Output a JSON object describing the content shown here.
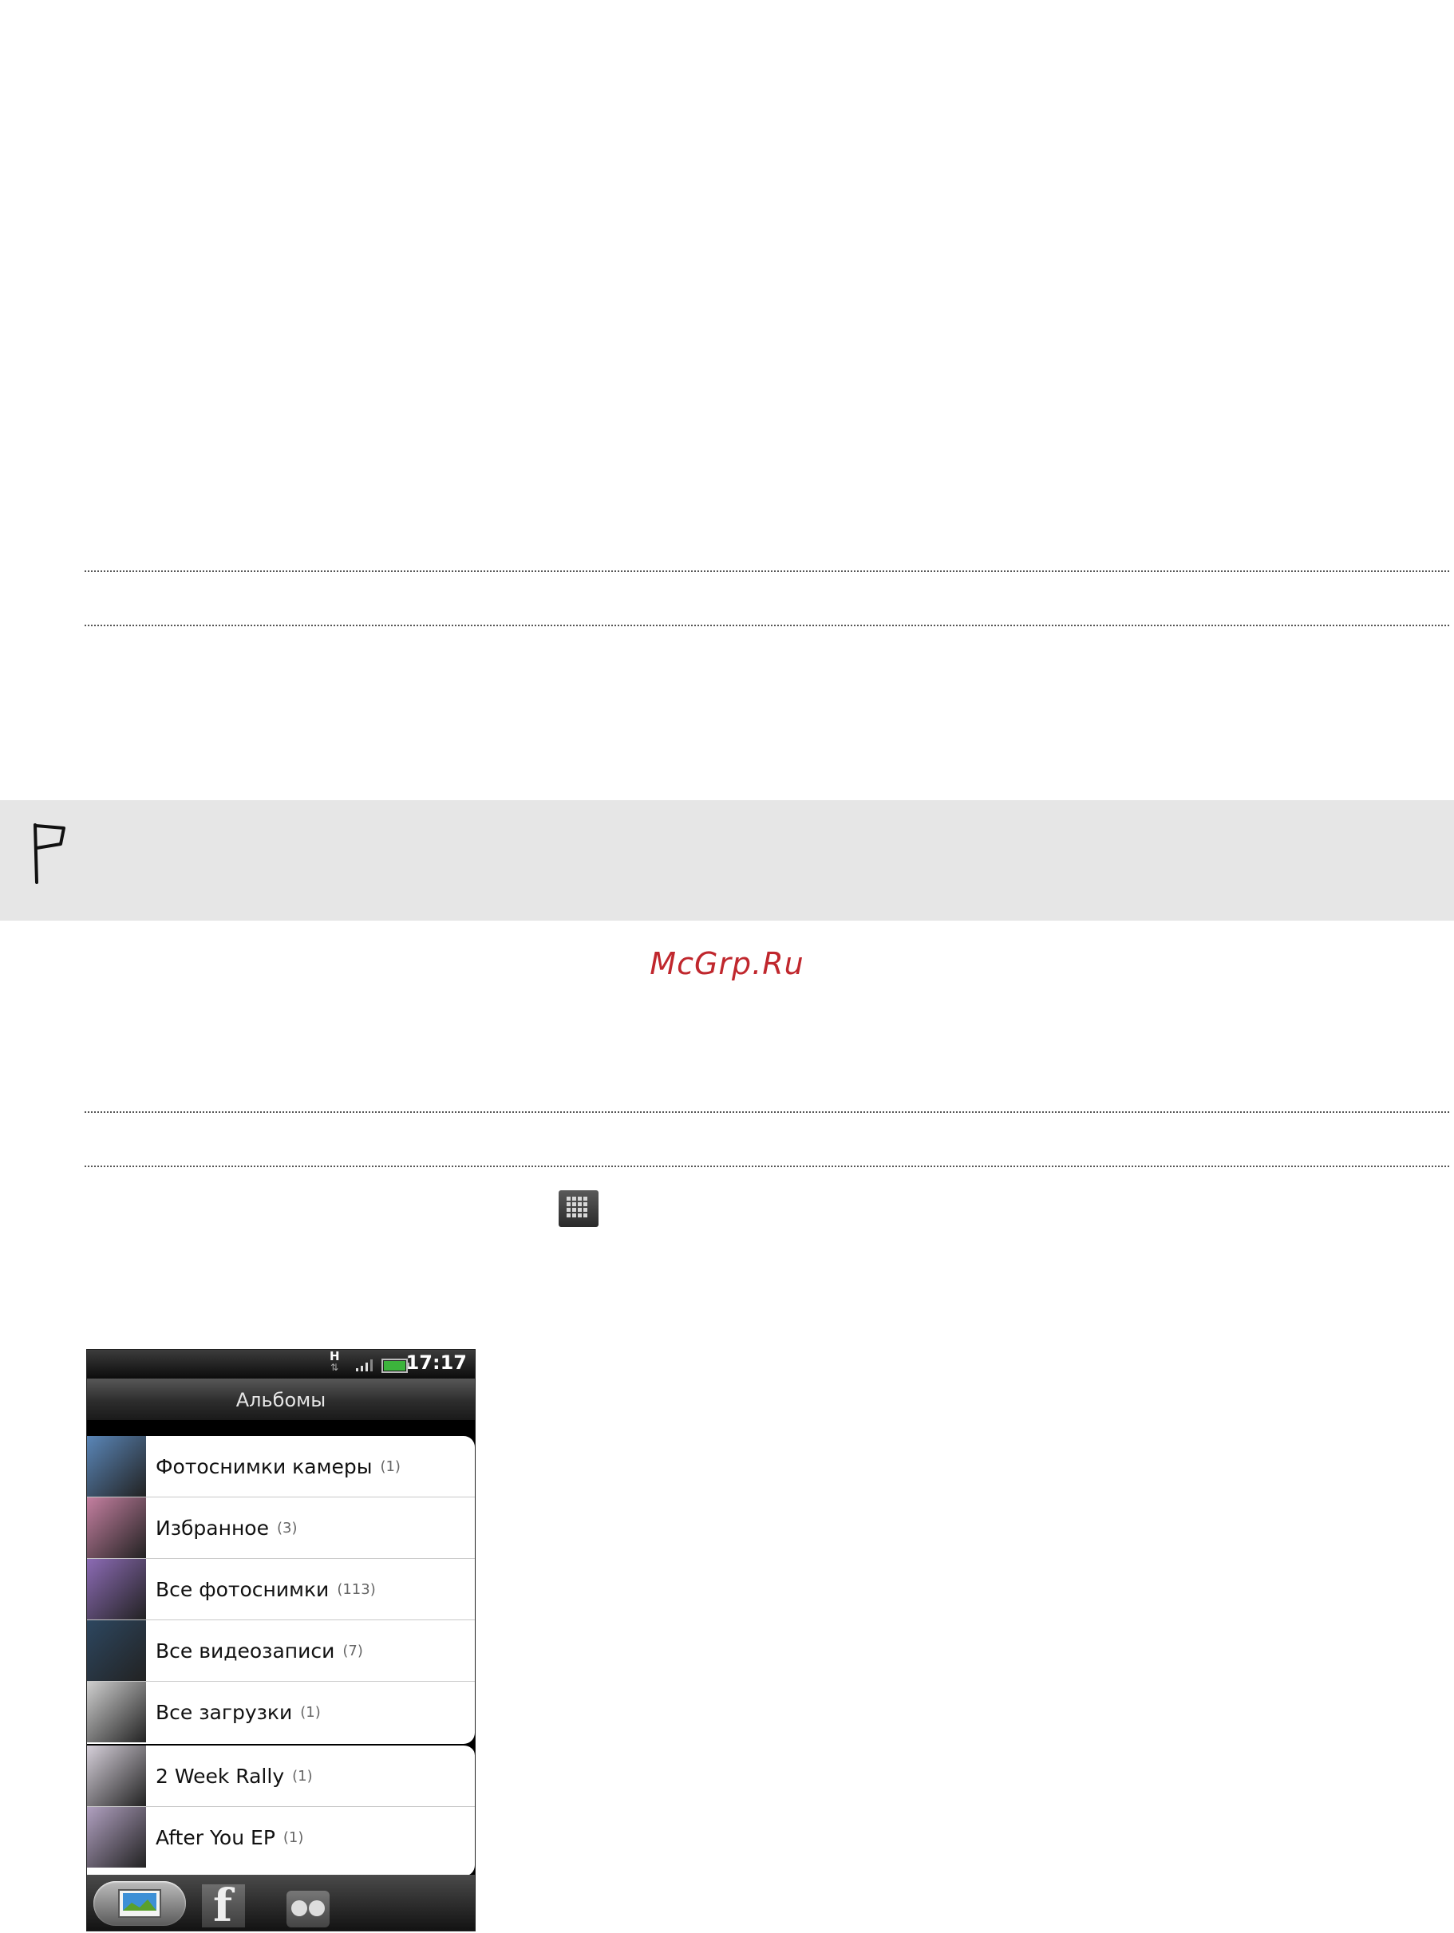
{
  "watermark": "McGrp.Ru",
  "icons": {
    "note": "flag-icon",
    "inline": "all-apps-icon"
  },
  "phone": {
    "status_bar": {
      "network": "H",
      "time": "17:17"
    },
    "title": "Альбомы",
    "album_groups": [
      [
        {
          "name": "Фотоснимки камеры",
          "count": "(1)",
          "thumb": "#5a86b8"
        },
        {
          "name": "Избранное",
          "count": "(3)",
          "thumb": "#c47fa0"
        },
        {
          "name": "Все фотоснимки",
          "count": "(113)",
          "thumb": "#8c6bb5"
        },
        {
          "name": "Все видеозаписи",
          "count": "(7)",
          "thumb": "#2d4760"
        },
        {
          "name": "Все загрузки",
          "count": "(1)",
          "thumb": "#cfcfcf"
        }
      ],
      [
        {
          "name": "2 Week Rally",
          "count": "(1)",
          "thumb": "#d6d0da"
        },
        {
          "name": "After You EP",
          "count": "(1)",
          "thumb": "#b0a0c0"
        }
      ]
    ],
    "tabs": [
      "gallery-icon",
      "facebook-icon",
      "flickr-icon"
    ]
  }
}
